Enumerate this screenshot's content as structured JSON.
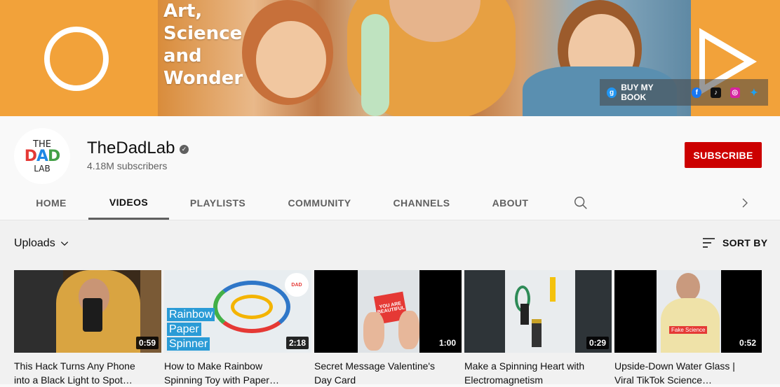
{
  "banner": {
    "tagline": [
      "Art,",
      "Science",
      "and",
      "Wonder"
    ],
    "link_badge": "g",
    "link_text": "BUY MY BOOK",
    "socials": [
      {
        "name": "facebook-icon",
        "glyph": "f",
        "color": "#1877f2"
      },
      {
        "name": "tiktok-icon",
        "glyph": "♪",
        "color": "#111111"
      },
      {
        "name": "instagram-icon",
        "glyph": "◎",
        "color": "#d6249f"
      },
      {
        "name": "twitter-icon",
        "glyph": "✦",
        "color": "#1da1f2"
      }
    ],
    "accent": "#f2a23a"
  },
  "channel": {
    "avatar_top": "THE",
    "avatar_mid": "DAD",
    "avatar_bottom": "LAB",
    "name": "TheDadLab",
    "verified_glyph": "✓",
    "subscribers": "4.18M subscribers",
    "subscribe_label": "SUBSCRIBE"
  },
  "tabs": [
    "HOME",
    "VIDEOS",
    "PLAYLISTS",
    "COMMUNITY",
    "CHANNELS",
    "ABOUT"
  ],
  "active_tab": "VIDEOS",
  "filter": {
    "uploads_label": "Uploads",
    "sort_label": "SORT BY"
  },
  "videos": [
    {
      "title1": "This Hack Turns Any Phone",
      "title2": "into a Black Light to Spot…",
      "duration": "0:59"
    },
    {
      "title1": "How to Make Rainbow",
      "title2": "Spinning Toy with Paper…",
      "duration": "2:18",
      "overlay": [
        "Rainbow",
        "Paper",
        "Spinner"
      ]
    },
    {
      "title1": "Secret Message Valentine's",
      "title2": "Day Card",
      "duration": "1:00",
      "card_text": "YOU ARE BEAUTIFUL"
    },
    {
      "title1": "Make a Spinning Heart with",
      "title2": "Electromagnetism",
      "duration": "0:29"
    },
    {
      "title1": "Upside-Down Water Glass |",
      "title2": "Viral TikTok Science…",
      "duration": "0:52",
      "label": "Fake Science"
    }
  ]
}
